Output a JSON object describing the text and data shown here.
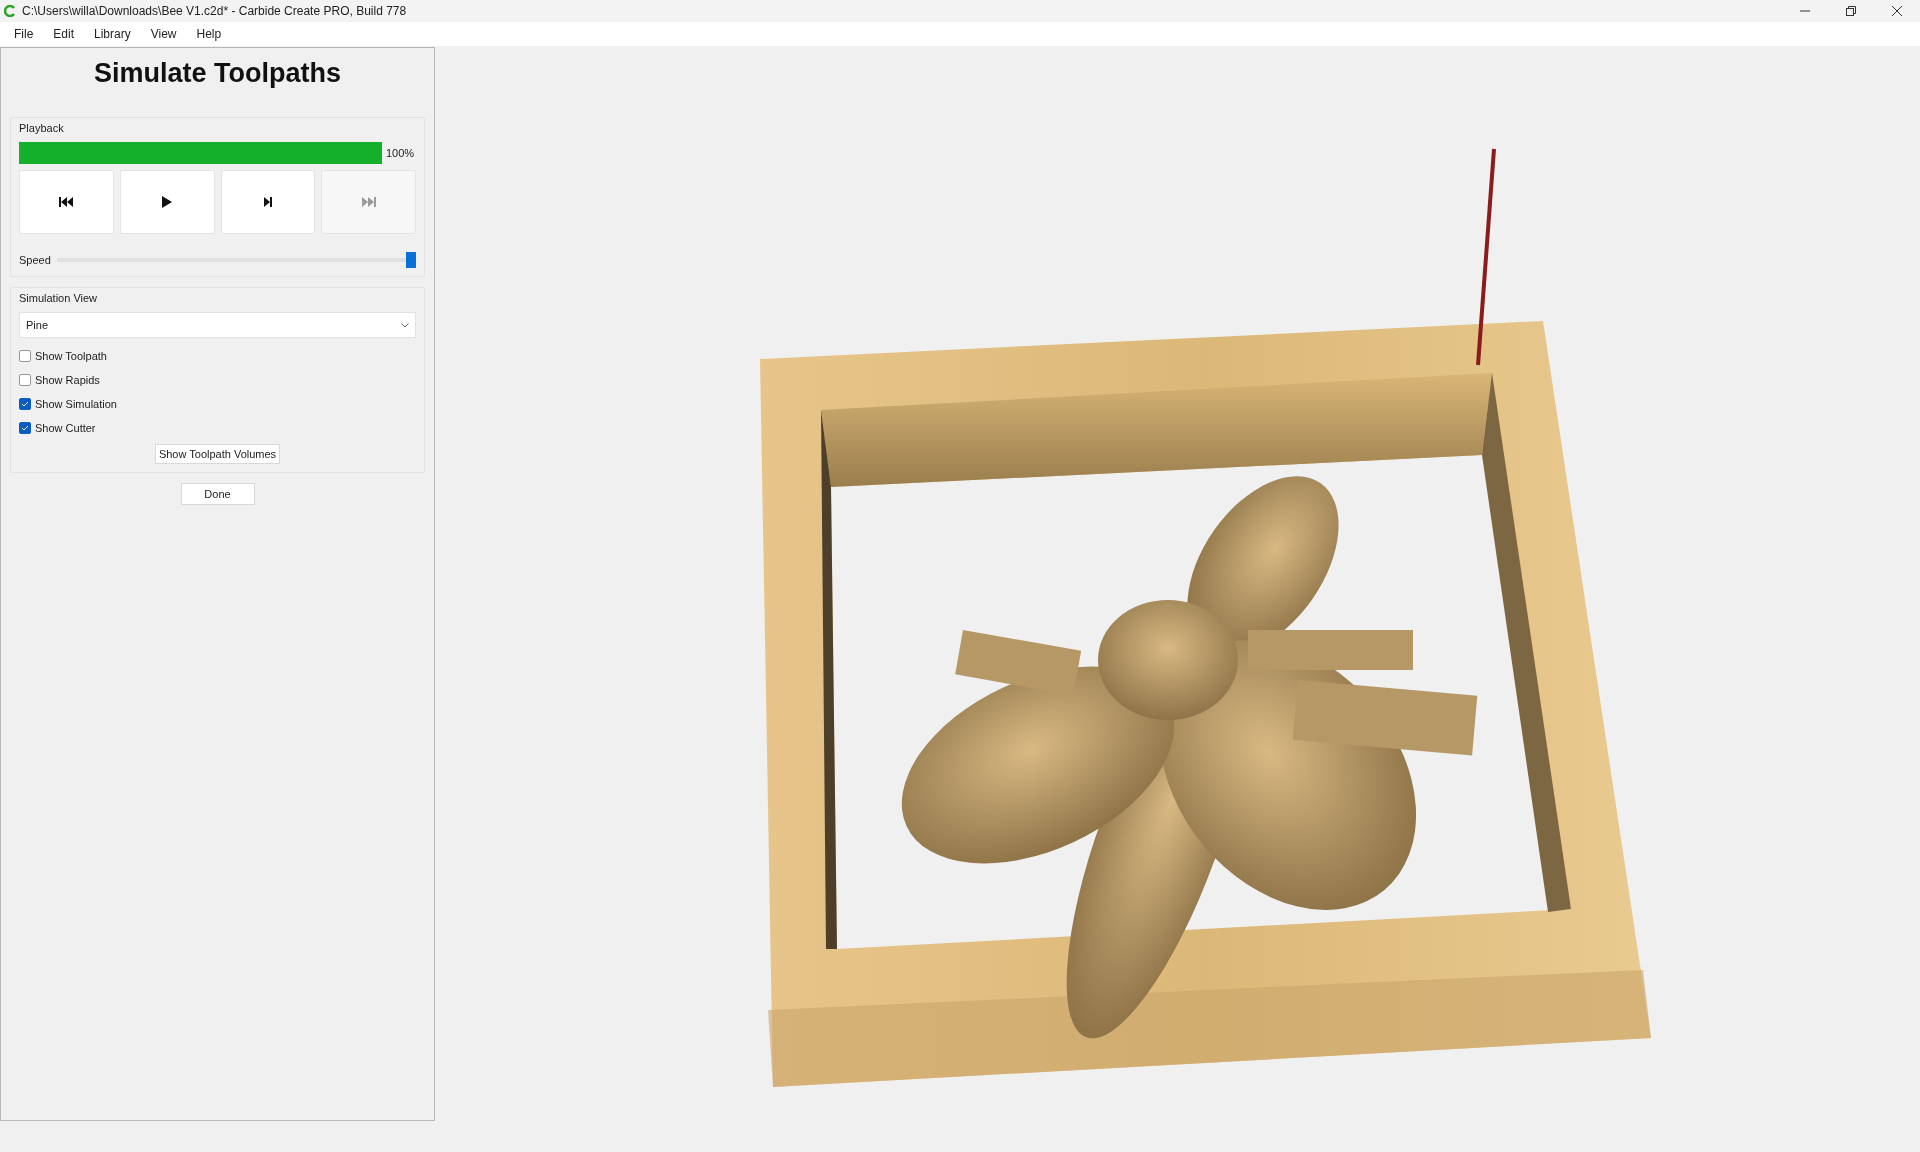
{
  "window": {
    "title": "C:\\Users\\willa\\Downloads\\Bee V1.c2d* - Carbide Create PRO, Build 778"
  },
  "menu": [
    {
      "label": "File"
    },
    {
      "label": "Edit"
    },
    {
      "label": "Library"
    },
    {
      "label": "View"
    },
    {
      "label": "Help"
    }
  ],
  "panel": {
    "title": "Simulate Toolpaths",
    "playback": {
      "label": "Playback",
      "progress": {
        "level": 1,
        "reading": "100%"
      },
      "buttons": [
        {
          "kind": "rewind",
          "disabled": false
        },
        {
          "kind": "play",
          "disabled": false
        },
        {
          "kind": "step",
          "disabled": false
        },
        {
          "kind": "end",
          "disabled": true
        }
      ],
      "speed": {
        "label": "Speed",
        "level": 1
      }
    },
    "simulation_view": {
      "label": "Simulation View",
      "material": {
        "value": "Pine"
      },
      "options": [
        {
          "label": "Show Toolpath",
          "checked": false
        },
        {
          "label": "Show Rapids",
          "checked": false
        },
        {
          "label": "Show Simulation",
          "checked": true
        },
        {
          "label": "Show Cutter",
          "checked": true
        }
      ],
      "volumes_button": "Show Toolpath Volumes"
    },
    "done_button": "Done"
  }
}
